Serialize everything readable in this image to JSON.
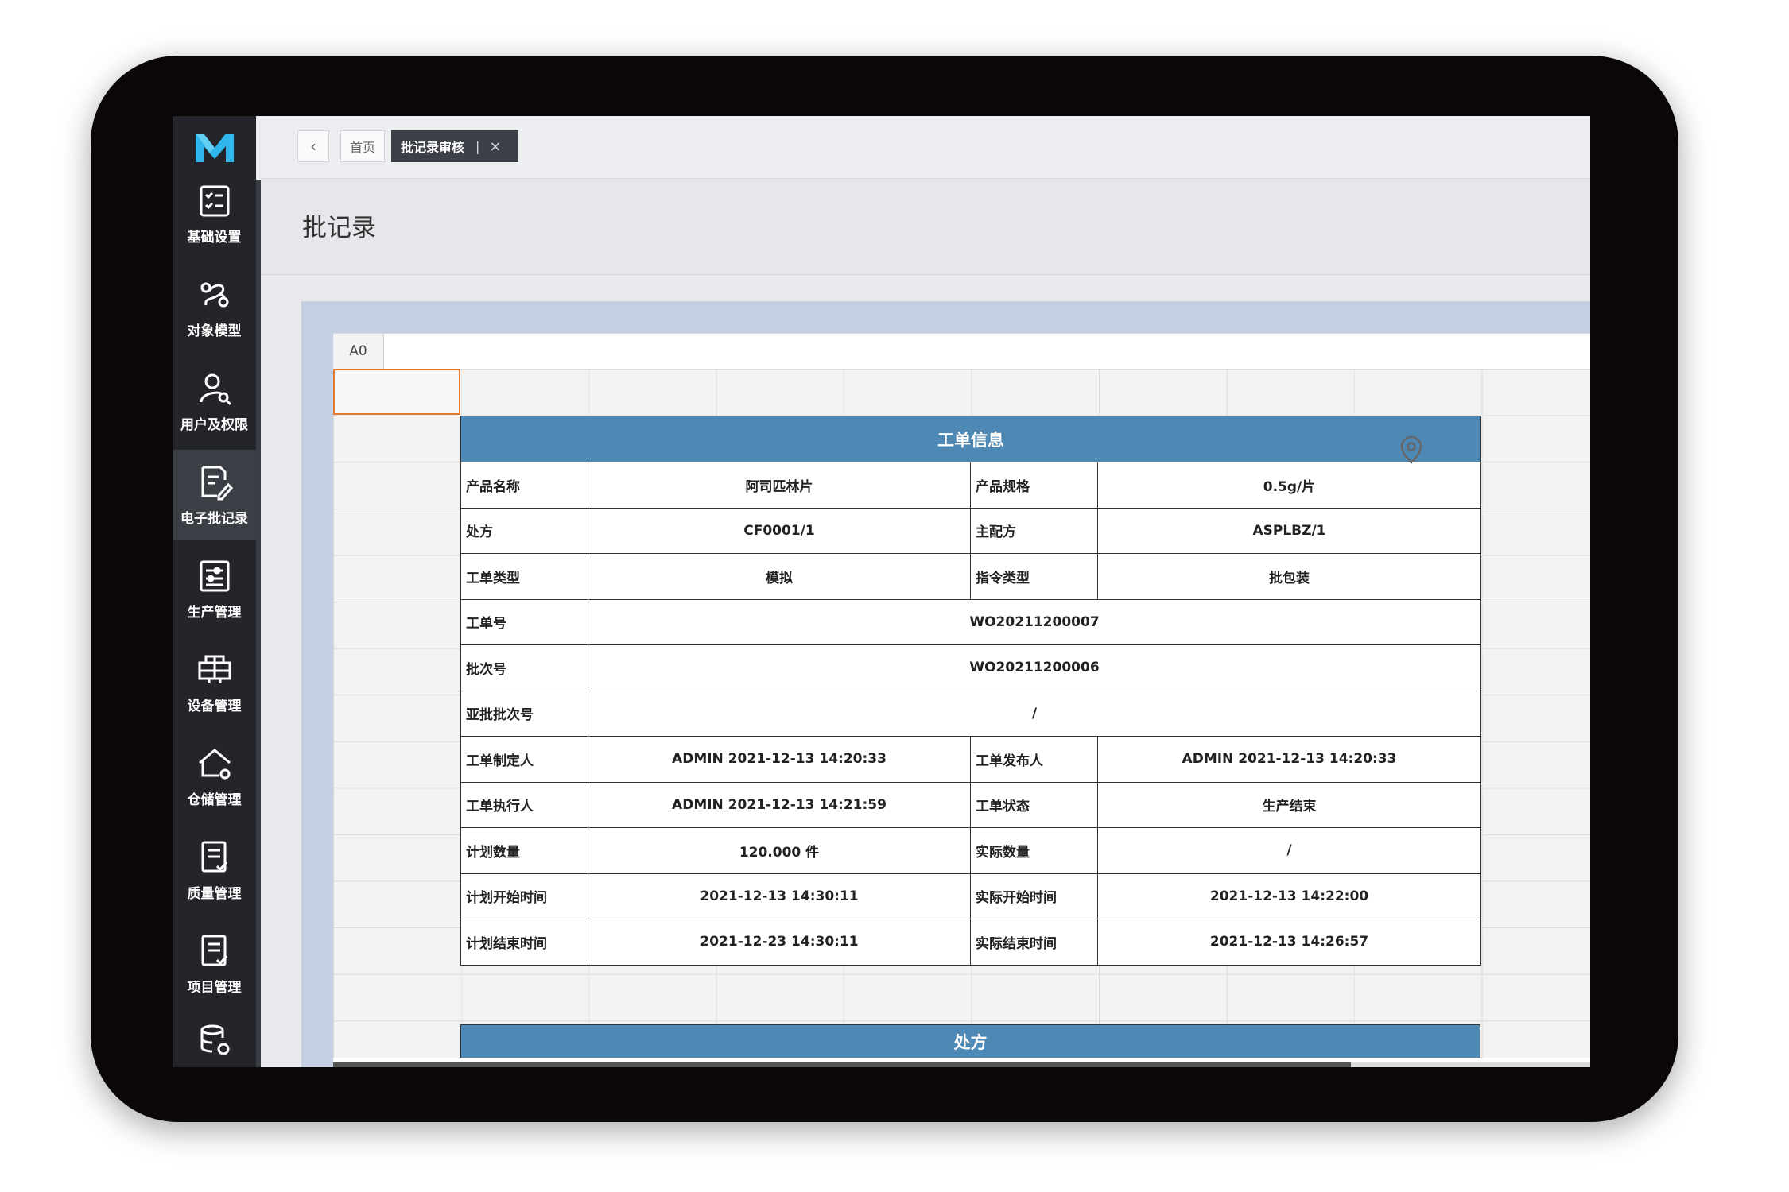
{
  "app": {
    "logo_text": "M"
  },
  "sidebar": {
    "items": [
      {
        "label": "基础设置",
        "icon": "list-settings-icon",
        "active": false
      },
      {
        "label": "对象模型",
        "icon": "model-icon",
        "active": false
      },
      {
        "label": "用户及权限",
        "icon": "user-permission-icon",
        "active": false
      },
      {
        "label": "电子批记录",
        "icon": "ebr-document-icon",
        "active": true
      },
      {
        "label": "生产管理",
        "icon": "production-icon",
        "active": false
      },
      {
        "label": "设备管理",
        "icon": "equipment-icon",
        "active": false
      },
      {
        "label": "仓储管理",
        "icon": "warehouse-icon",
        "active": false
      },
      {
        "label": "质量管理",
        "icon": "quality-icon",
        "active": false
      },
      {
        "label": "项目管理",
        "icon": "project-icon",
        "active": false
      }
    ]
  },
  "tabs": {
    "back": "‹",
    "home": "首页",
    "active": "批记录审核",
    "separator": "|",
    "close": "×"
  },
  "page": {
    "title": "批记录"
  },
  "sheet": {
    "cell_ref": "A0",
    "table_title": "工单信息",
    "section2_title": "处方",
    "rows": {
      "r1": {
        "l1": "产品名称",
        "v1": "阿司匹林片",
        "l2": "产品规格",
        "v2": "0.5g/片"
      },
      "r2": {
        "l1": "处方",
        "v1": "CF0001/1",
        "l2": "主配方",
        "v2": "ASPLBZ/1"
      },
      "r3": {
        "l1": "工单类型",
        "v1": "模拟",
        "l2": "指令类型",
        "v2": "批包装"
      },
      "r4": {
        "l1": "工单号",
        "v1": "WO20211200007"
      },
      "r5": {
        "l1": "批次号",
        "v1": "WO20211200006"
      },
      "r6": {
        "l1": "亚批批次号",
        "v1": "/"
      },
      "r7": {
        "l1": "工单制定人",
        "v1": "ADMIN 2021-12-13 14:20:33",
        "l2": "工单发布人",
        "v2": "ADMIN 2021-12-13 14:20:33"
      },
      "r8": {
        "l1": "工单执行人",
        "v1": "ADMIN 2021-12-13 14:21:59",
        "l2": "工单状态",
        "v2": "生产结束"
      },
      "r9": {
        "l1": "计划数量",
        "v1": "120.000 件",
        "l2": "实际数量",
        "v2": "/"
      },
      "r10": {
        "l1": "计划开始时间",
        "v1": "2021-12-13 14:30:11",
        "l2": "实际开始时间",
        "v2": "2021-12-13 14:22:00"
      },
      "r11": {
        "l1": "计划结束时间",
        "v1": "2021-12-23 14:30:11",
        "l2": "实际结束时间",
        "v2": "2021-12-13 14:26:57"
      }
    }
  },
  "colors": {
    "accent": "#4e88b4",
    "sidebar": "#23252b",
    "selection": "#e37b2e",
    "logo": "#2fb6ea"
  }
}
